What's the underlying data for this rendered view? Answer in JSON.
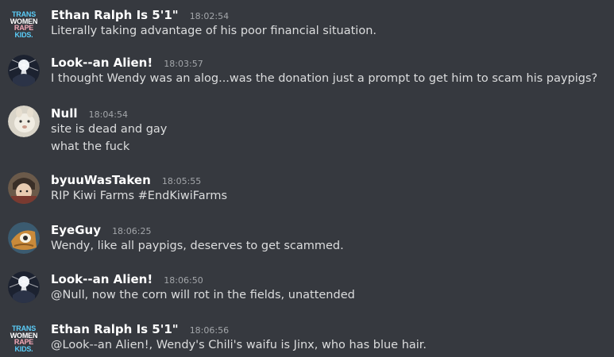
{
  "messages": [
    {
      "author": "Ethan Ralph Is 5'1\"",
      "time": "18:02:54",
      "avatar": "trans-women-logo",
      "lines": [
        "Literally taking advantage of his poor financial situation."
      ]
    },
    {
      "author": "Look--an Alien!",
      "time": "18:03:57",
      "avatar": "alien-avatar",
      "lines": [
        "I thought Wendy was an alog...was the donation just a prompt to get him to scam his paypigs?"
      ]
    },
    {
      "author": "Null",
      "time": "18:04:54",
      "avatar": "animal-avatar",
      "lines": [
        "site is dead and gay",
        "what the fuck"
      ]
    },
    {
      "author": "byuuWasTaken",
      "time": "18:05:55",
      "avatar": "anime-avatar",
      "lines": [
        "RIP Kiwi Farms #EndKiwiFarms"
      ]
    },
    {
      "author": "EyeGuy",
      "time": "18:06:25",
      "avatar": "eye-avatar",
      "lines": [
        "Wendy, like all paypigs, deserves to get scammed."
      ]
    },
    {
      "author": "Look--an Alien!",
      "time": "18:06:50",
      "avatar": "alien-avatar",
      "lines": [
        "@Null, now the corn will rot in the fields, unattended"
      ]
    },
    {
      "author": "Ethan Ralph Is 5'1\"",
      "time": "18:06:56",
      "avatar": "trans-women-logo",
      "lines": [
        "@Look--an Alien!, Wendy's Chili's waifu is Jinx, who has blue hair."
      ]
    }
  ],
  "logo_text": [
    "TRANS",
    "WOMEN",
    "RAPE",
    "KIDS."
  ],
  "colors": {
    "background": "#36393f",
    "name": "#ffffff",
    "timestamp": "#a3a6aa",
    "text": "#dcddde"
  }
}
